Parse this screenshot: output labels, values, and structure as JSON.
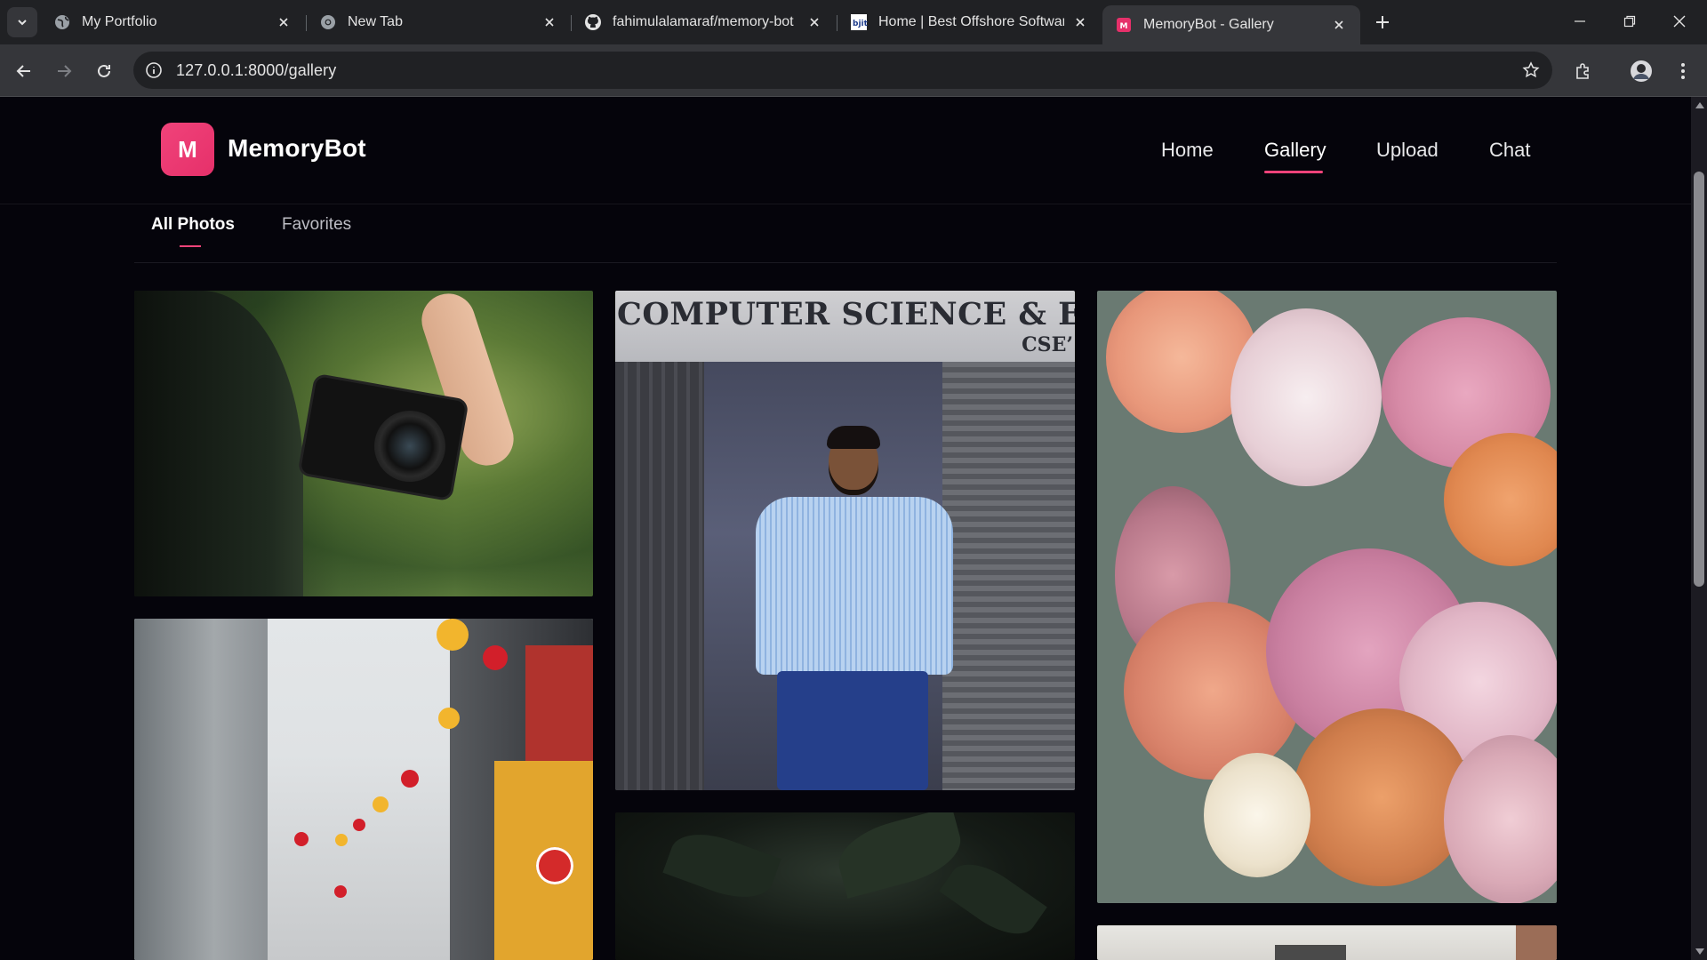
{
  "browser": {
    "tabs": [
      {
        "title": "My Portfolio",
        "favicon": "globe-icon"
      },
      {
        "title": "New Tab",
        "favicon": "chrome-icon"
      },
      {
        "title": "fahimulalamaraf/memory-bot",
        "favicon": "github-icon"
      },
      {
        "title": "Home | Best Offshore Software",
        "favicon": "bjit-icon"
      },
      {
        "title": "MemoryBot - Gallery",
        "favicon": "memorybot-icon",
        "active": true
      }
    ],
    "url": "127.0.0.1:8000/gallery"
  },
  "app": {
    "logo_letter": "M",
    "name": "MemoryBot",
    "accent": "#f0437a",
    "nav": [
      {
        "label": "Home"
      },
      {
        "label": "Gallery",
        "active": true
      },
      {
        "label": "Upload"
      },
      {
        "label": "Chat"
      }
    ]
  },
  "gallery": {
    "tabs": [
      {
        "label": "All Photos",
        "active": true
      },
      {
        "label": "Favorites"
      }
    ],
    "photos": [
      {
        "alt": "Hand holding a minolta camera"
      },
      {
        "alt": "Man standing in front of Computer Science & Engineering building",
        "sign_text": "COMPUTER SCIENCE & ENGINEERIN",
        "sign_sub": "CSE’"
      },
      {
        "alt": "Bouquet of peach and pink peonies"
      },
      {
        "alt": "Street with red and yellow lanterns"
      },
      {
        "alt": "Dark foliage"
      },
      {
        "alt": "Building rooftop"
      }
    ]
  }
}
